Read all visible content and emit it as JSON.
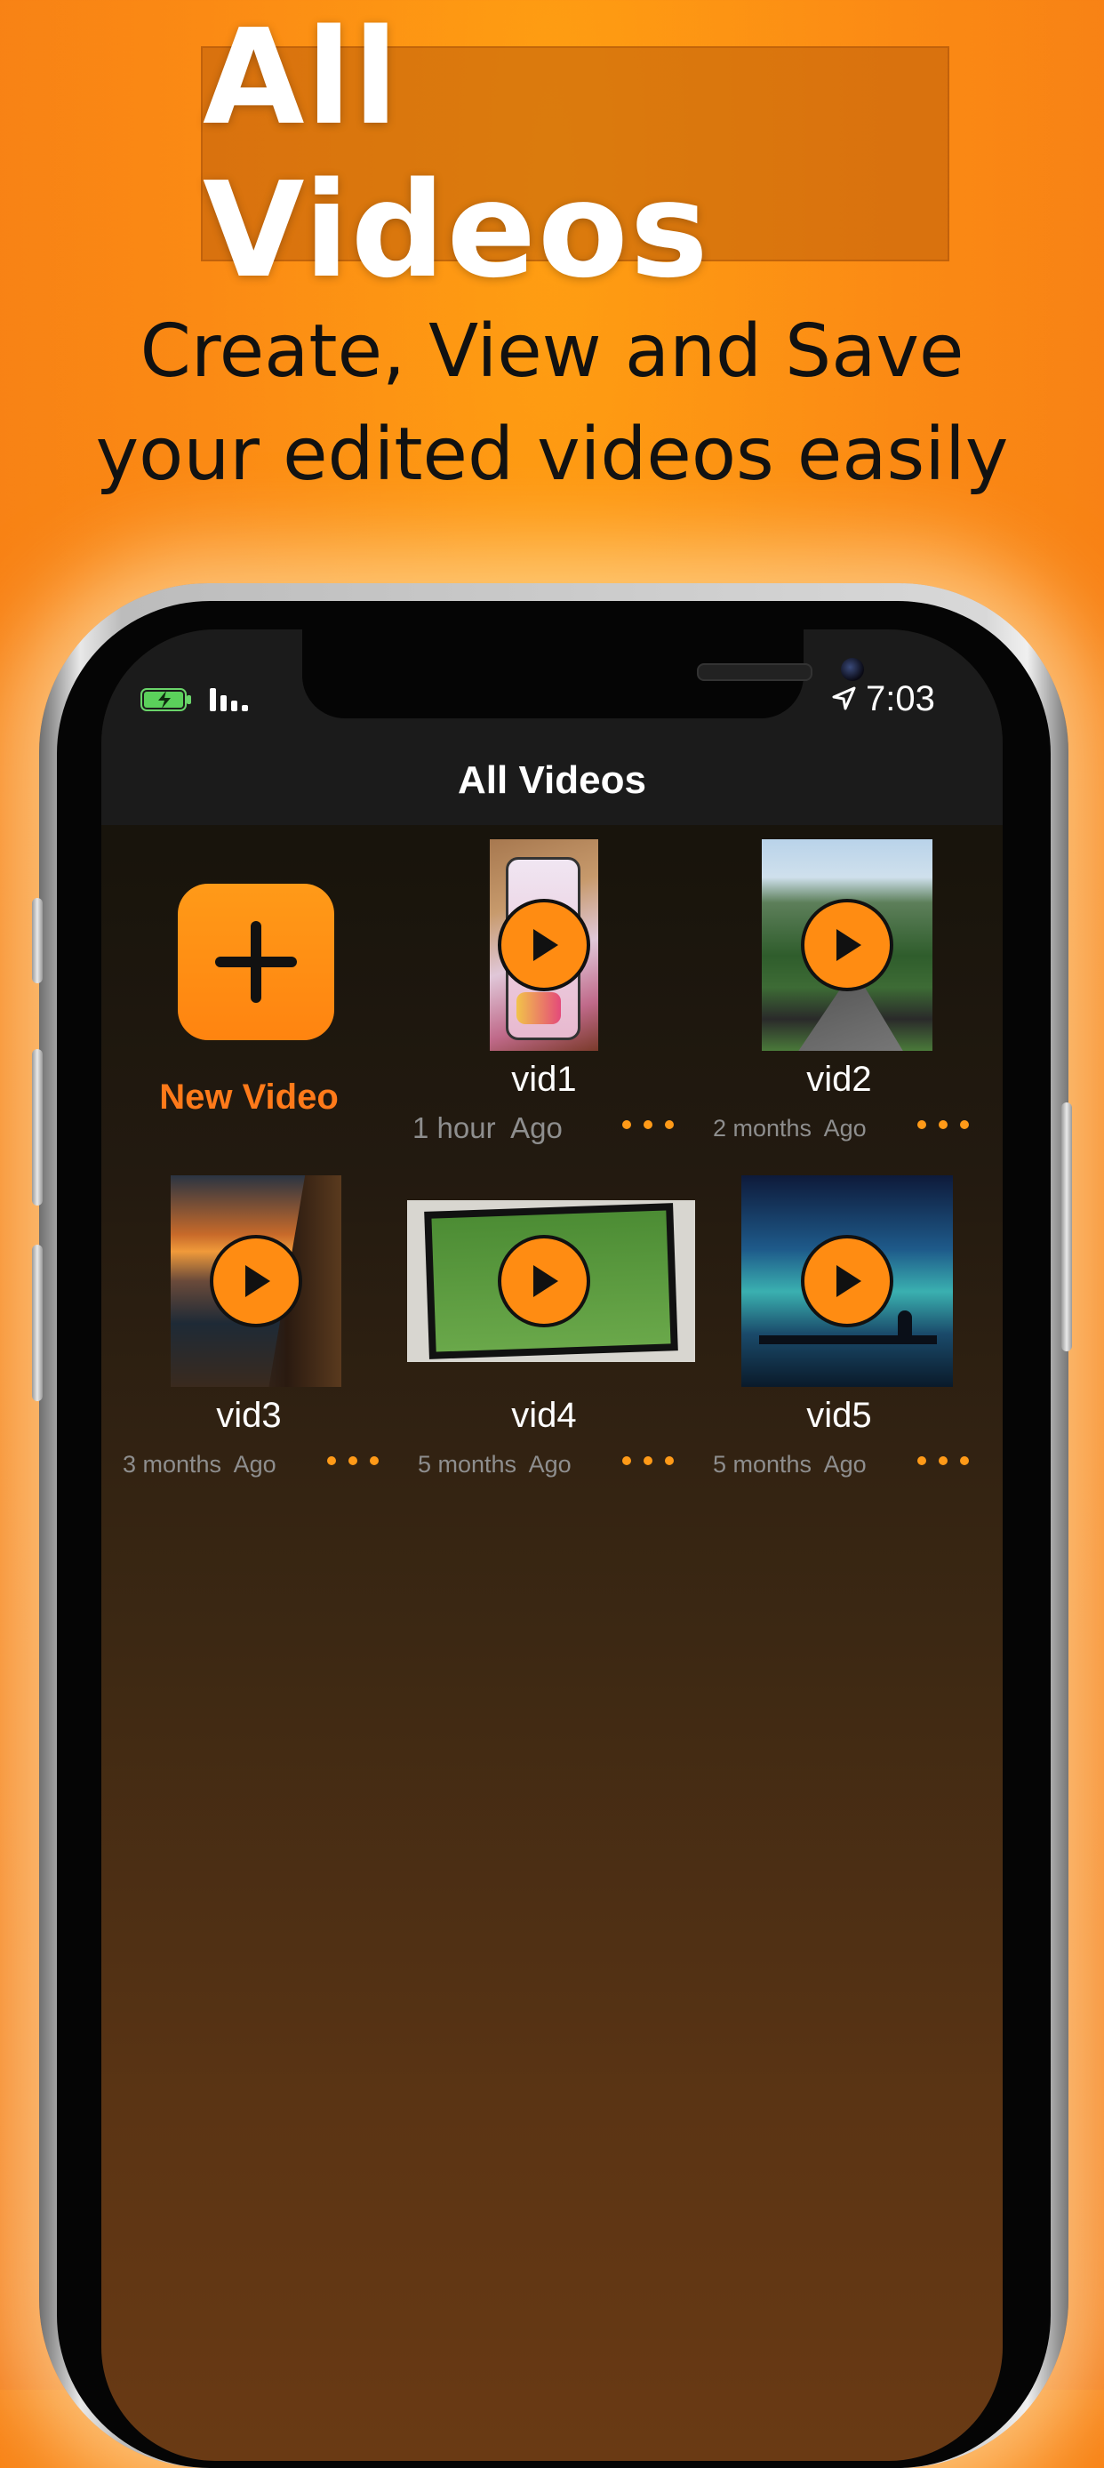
{
  "promo": {
    "title": "All Videos",
    "subtitle_line1": "Create, View and Save",
    "subtitle_line2": "your edited videos easily"
  },
  "status_bar": {
    "time": "7:03",
    "icons": [
      "battery-charging-icon",
      "signal-icon",
      "location-arrow-icon"
    ]
  },
  "nav": {
    "title": "All Videos"
  },
  "new_video": {
    "label": "New Video",
    "icon": "plus-icon"
  },
  "videos": [
    {
      "name": "vid1",
      "time": "1 hour  Ago",
      "thumbnail": "phone screen with headphones app"
    },
    {
      "name": "vid2",
      "time": "2 months  Ago",
      "thumbnail": "green mountain road"
    },
    {
      "name": "vid3",
      "time": "3 months  Ago",
      "thumbnail": "sunset from ship deck"
    },
    {
      "name": "vid4",
      "time": "5 months  Ago",
      "thumbnail": "soccer match on tv"
    },
    {
      "name": "vid5",
      "time": "5 months  Ago",
      "thumbnail": "starry night sky with silhouette"
    }
  ],
  "colors": {
    "accent": "#ff8c12",
    "new_video_label": "#ff7a1a",
    "background_orange": "#fb8a14",
    "nav_bar": "#1b1b1b"
  }
}
